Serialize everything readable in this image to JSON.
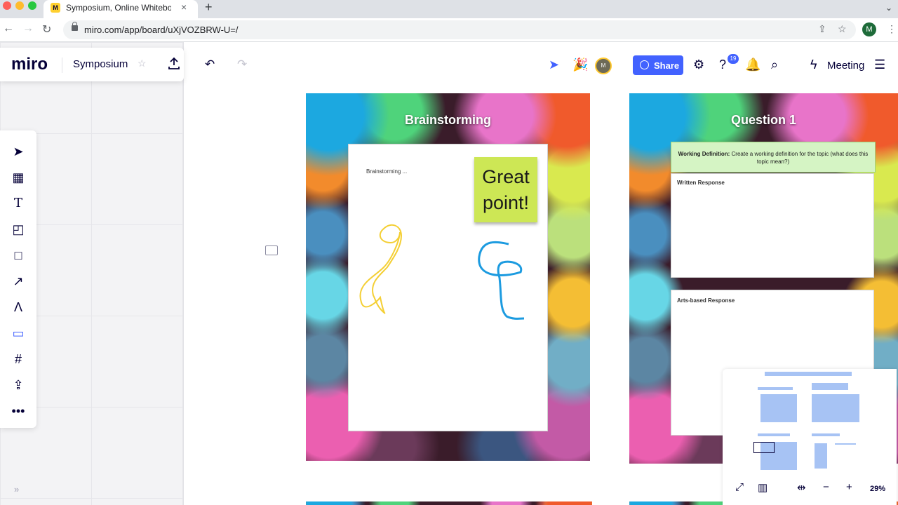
{
  "browser": {
    "tab_title": "Symposium, Online Whiteboard",
    "tab_icon": "miro-favicon",
    "url": "miro.com/app/board/uXjVOZBRW-U=/",
    "profile_initial": "M"
  },
  "board": {
    "logo": "miro",
    "name": "Symposium",
    "share_label": "Share",
    "notification_count": "19",
    "meeting_label": "Meeting",
    "avatar_initial": "M",
    "accent_color": "#4262ff"
  },
  "frames": {
    "brainstorm": {
      "title": "Brainstorming",
      "card_text": "Brainstorming ...",
      "sticky_line1": "Great",
      "sticky_line2": "point!",
      "sticky_color": "#cde755"
    },
    "question1": {
      "title": "Question 1",
      "definition_label": "Working Definition:",
      "definition_text": "Create a working definition for the topic (what does this topic mean?)",
      "written_label": "Written Response",
      "arts_label": "Arts-based Response"
    }
  },
  "minimap": {
    "zoom": "29%"
  }
}
